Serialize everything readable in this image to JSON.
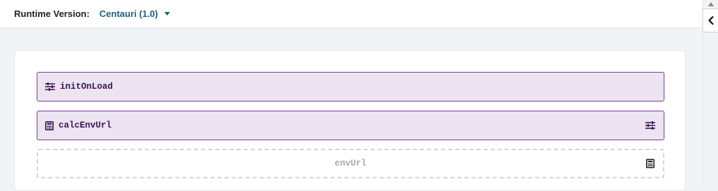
{
  "header": {
    "runtime_label": "Runtime Version:",
    "runtime_value": "Centauri (1.0)"
  },
  "blocks": [
    {
      "label": "initOnLoad",
      "icon": "sliders-icon",
      "state": "filled"
    },
    {
      "label": "calcEnvUrl",
      "icon": "calculator-icon",
      "state": "filled",
      "action_icon": "sliders-icon"
    },
    {
      "label": "envUrl",
      "state": "placeholder",
      "action_icon": "calculator-icon"
    }
  ],
  "colors": {
    "accent": "#1f5d80",
    "block_fill": "#ece4f0",
    "block_border": "#7b3a9a",
    "block_text": "#3c1558",
    "placeholder_text": "#aaaaaa"
  }
}
